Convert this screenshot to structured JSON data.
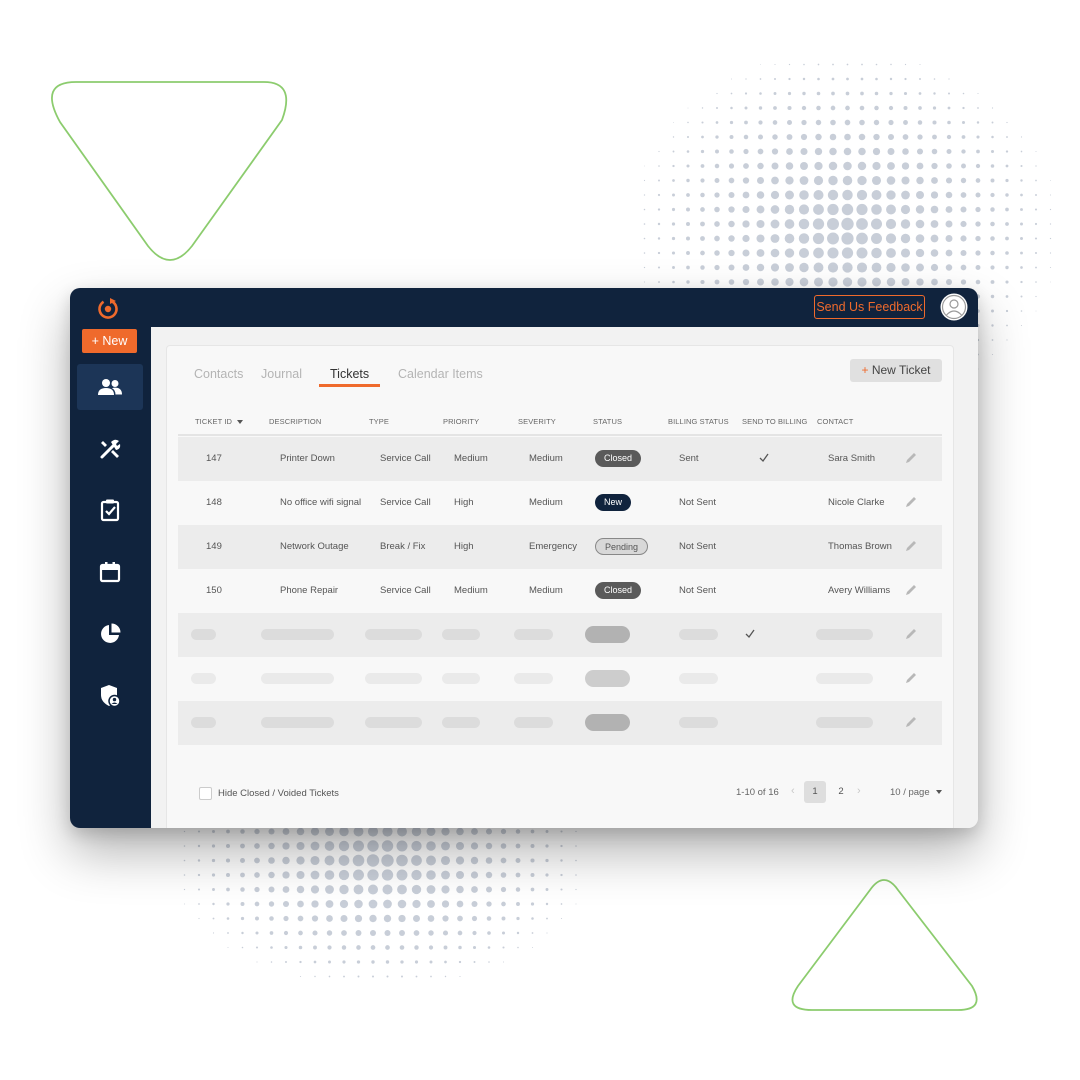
{
  "topbar": {
    "feedback_label": "Send Us Feedback"
  },
  "sidebar": {
    "new_label": "+ New",
    "items": [
      {
        "name": "contacts",
        "icon": "people-icon",
        "active": true
      },
      {
        "name": "tools",
        "icon": "tools-icon",
        "active": false
      },
      {
        "name": "tasks",
        "icon": "clipboard-check-icon",
        "active": false
      },
      {
        "name": "calendar",
        "icon": "calendar-icon",
        "active": false
      },
      {
        "name": "reports",
        "icon": "pie-chart-icon",
        "active": false
      },
      {
        "name": "admin",
        "icon": "shield-user-icon",
        "active": false
      }
    ]
  },
  "tabs": [
    {
      "label": "Contacts",
      "active": false
    },
    {
      "label": "Journal",
      "active": false
    },
    {
      "label": "Tickets",
      "active": true
    },
    {
      "label": "Calendar Items",
      "active": false
    }
  ],
  "new_ticket_label": "New Ticket",
  "table": {
    "columns": [
      "TICKET ID",
      "DESCRIPTION",
      "TYPE",
      "PRIORITY",
      "SEVERITY",
      "STATUS",
      "BILLING STATUS",
      "SEND TO BILLING",
      "CONTACT"
    ],
    "rows": [
      {
        "id": "147",
        "description": "Printer Down",
        "type": "Service Call",
        "priority": "Medium",
        "severity": "Medium",
        "status": "Closed",
        "billing": "Sent",
        "send_to_billing": true,
        "contact": "Sara Smith"
      },
      {
        "id": "148",
        "description": "No office wifi signal",
        "type": "Service Call",
        "priority": "High",
        "severity": "Medium",
        "status": "New",
        "billing": "Not Sent",
        "send_to_billing": false,
        "contact": "Nicole Clarke"
      },
      {
        "id": "149",
        "description": "Network Outage",
        "type": "Break / Fix",
        "priority": "High",
        "severity": "Emergency",
        "status": "Pending",
        "billing": "Not Sent",
        "send_to_billing": false,
        "contact": "Thomas Brown"
      },
      {
        "id": "150",
        "description": "Phone Repair",
        "type": "Service Call",
        "priority": "Medium",
        "severity": "Medium",
        "status": "Closed",
        "billing": "Not Sent",
        "send_to_billing": false,
        "contact": "Avery Williams"
      }
    ],
    "placeholder_rows": [
      {
        "send_to_billing": true
      },
      {
        "send_to_billing": false
      },
      {
        "send_to_billing": false
      }
    ]
  },
  "footer": {
    "hide_closed_label": "Hide Closed / Voided Tickets",
    "range_label": "1-10 of 16",
    "pages": [
      "1",
      "2"
    ],
    "current_page": "1",
    "page_size_label": "10 / page"
  },
  "colors": {
    "navy": "#10233d",
    "accent": "#ef6a2c",
    "decor_green": "#8ccc6e",
    "dot_grey": "#9aa5b8"
  }
}
